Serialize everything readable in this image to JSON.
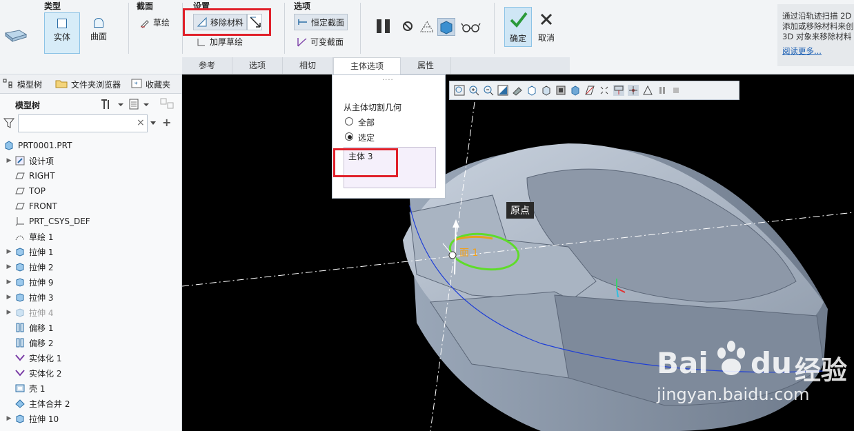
{
  "ribbon": {
    "groups": {
      "type": "类型",
      "section": "截面",
      "settings": "设置",
      "options": "选项"
    },
    "buttons": {
      "solid": "实体",
      "surface": "曲面",
      "sketch": "草绘",
      "remove_material": "移除材料",
      "thicken_sketch": "加厚草绘",
      "constant_section": "恒定截面",
      "variable_section": "可变截面",
      "ok": "确定",
      "cancel": "取消"
    },
    "tabs": [
      "参考",
      "选项",
      "相切",
      "主体选项",
      "属性"
    ],
    "help_text": {
      "line1": "通过沿轨迹扫描 2D",
      "line2": "添加或移除材料来创",
      "line3": "3D 对象来移除材料",
      "link": "阅读更多..."
    }
  },
  "left_panel": {
    "tabs": [
      "模型树",
      "文件夹浏览器",
      "收藏夹"
    ],
    "toolbar_title": "模型树",
    "search_value": "",
    "tree": [
      {
        "label": "PRT0001.PRT",
        "expand": false,
        "icon": "part-icon",
        "level": 0
      },
      {
        "label": "设计项",
        "expand": true,
        "icon": "design-items-icon",
        "level": 1
      },
      {
        "label": "RIGHT",
        "expand": false,
        "icon": "datum-plane-icon",
        "level": 1
      },
      {
        "label": "TOP",
        "expand": false,
        "icon": "datum-plane-icon",
        "level": 1
      },
      {
        "label": "FRONT",
        "expand": false,
        "icon": "datum-plane-icon",
        "level": 1
      },
      {
        "label": "PRT_CSYS_DEF",
        "expand": false,
        "icon": "csys-icon",
        "level": 1
      },
      {
        "label": "草绘 1",
        "expand": false,
        "icon": "sketch-icon",
        "level": 1
      },
      {
        "label": "拉伸 1",
        "expand": true,
        "icon": "extrude-icon",
        "level": 1
      },
      {
        "label": "拉伸 2",
        "expand": true,
        "icon": "extrude-icon",
        "level": 1
      },
      {
        "label": "拉伸 9",
        "expand": true,
        "icon": "extrude-icon",
        "level": 1
      },
      {
        "label": "拉伸 3",
        "expand": true,
        "icon": "extrude-icon",
        "level": 1
      },
      {
        "label": "拉伸 4",
        "expand": true,
        "icon": "extrude-icon",
        "level": 1,
        "dim": true
      },
      {
        "label": "偏移 1",
        "expand": false,
        "icon": "offset-icon",
        "level": 1
      },
      {
        "label": "偏移 2",
        "expand": false,
        "icon": "offset-icon",
        "level": 1
      },
      {
        "label": "实体化 1",
        "expand": false,
        "icon": "solidify-icon",
        "level": 1
      },
      {
        "label": "实体化 2",
        "expand": false,
        "icon": "solidify-icon",
        "level": 1
      },
      {
        "label": "壳 1",
        "expand": false,
        "icon": "shell-icon",
        "level": 1
      },
      {
        "label": "主体合并 2",
        "expand": false,
        "icon": "body-merge-icon",
        "level": 1
      },
      {
        "label": "拉伸 10",
        "expand": true,
        "icon": "extrude-icon",
        "level": 1
      }
    ]
  },
  "body_options_panel": {
    "title": "从主体切割几何",
    "radio_all": "全部",
    "radio_selected": "选定",
    "selected_body": "主体 3"
  },
  "viewport": {
    "annotation_origin": "原点",
    "annotation_face": "面 1"
  },
  "watermark": {
    "brand": "Bai",
    "brand2": "du",
    "cn": "经验",
    "url": "jingyan.baidu.com"
  }
}
